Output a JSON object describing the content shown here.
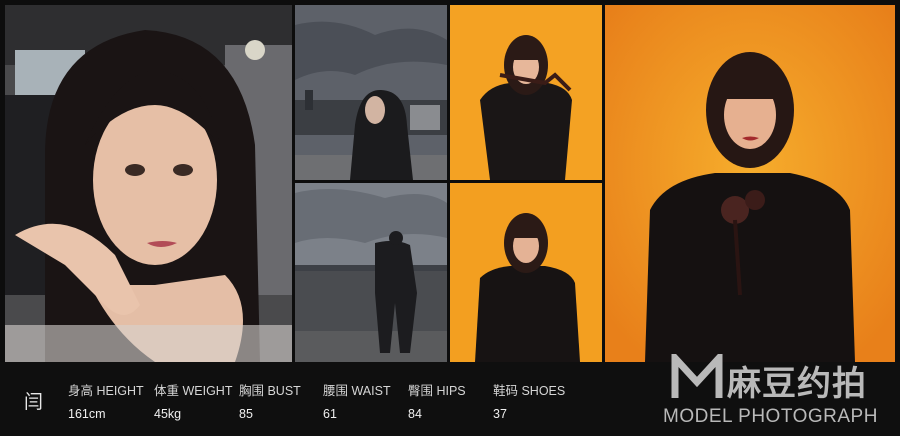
{
  "model": {
    "name_glyph": "闫"
  },
  "stats": [
    {
      "label": "身高 HEIGHT",
      "value": "161cm"
    },
    {
      "label": "体重 WEIGHT",
      "value": "45kg"
    },
    {
      "label": "胸围 BUST",
      "value": "85"
    },
    {
      "label": "腰围 WAIST",
      "value": "61"
    },
    {
      "label": "臀围 HIPS",
      "value": "84"
    },
    {
      "label": "鞋码 SHOES",
      "value": "37"
    }
  ],
  "brand": {
    "logo_mark": "M",
    "name_cn": "麻豆约拍",
    "name_en": "MODEL PHOTOGRAPH"
  },
  "colors": {
    "accent_orange": "#f2a21c",
    "background": "#0d0d0d",
    "text": "#e8e8e8"
  }
}
